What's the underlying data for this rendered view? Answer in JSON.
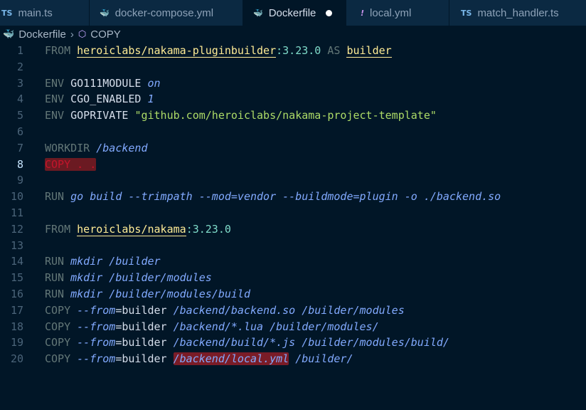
{
  "tabs": [
    {
      "icon": "TS",
      "label": "main.ts"
    },
    {
      "icon": "docker-compose",
      "label": "docker-compose.yml"
    },
    {
      "icon": "docker",
      "label": "Dockerfile",
      "active": true,
      "modified": true
    },
    {
      "icon": "yml",
      "label": "local.yml"
    },
    {
      "icon": "TS",
      "label": "match_handler.ts"
    }
  ],
  "breadcrumb": {
    "file": "Dockerfile",
    "symbol": "COPY"
  },
  "current_line": 8,
  "code_lines": [
    {
      "n": "1",
      "tokens": [
        {
          "t": "FROM",
          "c": "kw"
        },
        {
          "t": " "
        },
        {
          "t": "heroiclabs/nakama-pluginbuilder",
          "c": "img"
        },
        {
          "t": ":3.23.0",
          "c": "tag"
        },
        {
          "t": " "
        },
        {
          "t": "AS",
          "c": "kw"
        },
        {
          "t": " "
        },
        {
          "t": "builder",
          "c": "img"
        }
      ]
    },
    {
      "n": "2",
      "tokens": []
    },
    {
      "n": "3",
      "tokens": [
        {
          "t": "ENV",
          "c": "kw"
        },
        {
          "t": " GO111MODULE "
        },
        {
          "t": "on",
          "c": "ital"
        }
      ]
    },
    {
      "n": "4",
      "tokens": [
        {
          "t": "ENV",
          "c": "kw"
        },
        {
          "t": " CGO_ENABLED "
        },
        {
          "t": "1",
          "c": "ital"
        }
      ]
    },
    {
      "n": "5",
      "tokens": [
        {
          "t": "ENV",
          "c": "kw"
        },
        {
          "t": " GOPRIVATE "
        },
        {
          "t": "\"github.com/heroiclabs/nakama-project-template\"",
          "c": "str"
        }
      ]
    },
    {
      "n": "6",
      "tokens": []
    },
    {
      "n": "7",
      "tokens": [
        {
          "t": "WORKDIR",
          "c": "kw"
        },
        {
          "t": " "
        },
        {
          "t": "/backend",
          "c": "ital"
        }
      ]
    },
    {
      "n": "8",
      "tokens": [
        {
          "t": "COPY . .",
          "c": "err"
        }
      ]
    },
    {
      "n": "9",
      "tokens": []
    },
    {
      "n": "10",
      "tokens": [
        {
          "t": "RUN",
          "c": "kw"
        },
        {
          "t": " "
        },
        {
          "t": "go build --trimpath --mod=vendor --buildmode=plugin -o ./backend.so",
          "c": "ital"
        }
      ]
    },
    {
      "n": "11",
      "tokens": []
    },
    {
      "n": "12",
      "tokens": [
        {
          "t": "FROM",
          "c": "kw"
        },
        {
          "t": " "
        },
        {
          "t": "heroiclabs/nakama",
          "c": "img"
        },
        {
          "t": ":3.23.0",
          "c": "tag"
        }
      ]
    },
    {
      "n": "13",
      "tokens": []
    },
    {
      "n": "14",
      "tokens": [
        {
          "t": "RUN",
          "c": "kw"
        },
        {
          "t": " "
        },
        {
          "t": "mkdir /builder",
          "c": "ital"
        }
      ]
    },
    {
      "n": "15",
      "tokens": [
        {
          "t": "RUN",
          "c": "kw"
        },
        {
          "t": " "
        },
        {
          "t": "mkdir /builder/modules",
          "c": "ital"
        }
      ]
    },
    {
      "n": "16",
      "tokens": [
        {
          "t": "RUN",
          "c": "kw"
        },
        {
          "t": " "
        },
        {
          "t": "mkdir /builder/modules/build",
          "c": "ital"
        }
      ]
    },
    {
      "n": "17",
      "tokens": [
        {
          "t": "COPY",
          "c": "kw"
        },
        {
          "t": " "
        },
        {
          "t": "--from",
          "c": "ital"
        },
        {
          "t": "=builder "
        },
        {
          "t": "/backend/backend.so /builder/modules",
          "c": "ital"
        }
      ]
    },
    {
      "n": "18",
      "tokens": [
        {
          "t": "COPY",
          "c": "kw"
        },
        {
          "t": " "
        },
        {
          "t": "--from",
          "c": "ital"
        },
        {
          "t": "=builder "
        },
        {
          "t": "/backend/*.lua /builder/modules/",
          "c": "ital"
        }
      ]
    },
    {
      "n": "19",
      "tokens": [
        {
          "t": "COPY",
          "c": "kw"
        },
        {
          "t": " "
        },
        {
          "t": "--from",
          "c": "ital"
        },
        {
          "t": "=builder "
        },
        {
          "t": "/backend/build/*.js /builder/modules/build/",
          "c": "ital"
        }
      ]
    },
    {
      "n": "20",
      "tokens": [
        {
          "t": "COPY",
          "c": "kw"
        },
        {
          "t": " "
        },
        {
          "t": "--from",
          "c": "ital"
        },
        {
          "t": "=builder "
        },
        {
          "t": "/backend/local.yml",
          "c": "errpath"
        },
        {
          "t": " "
        },
        {
          "t": "/builder/",
          "c": "ital"
        }
      ]
    }
  ]
}
